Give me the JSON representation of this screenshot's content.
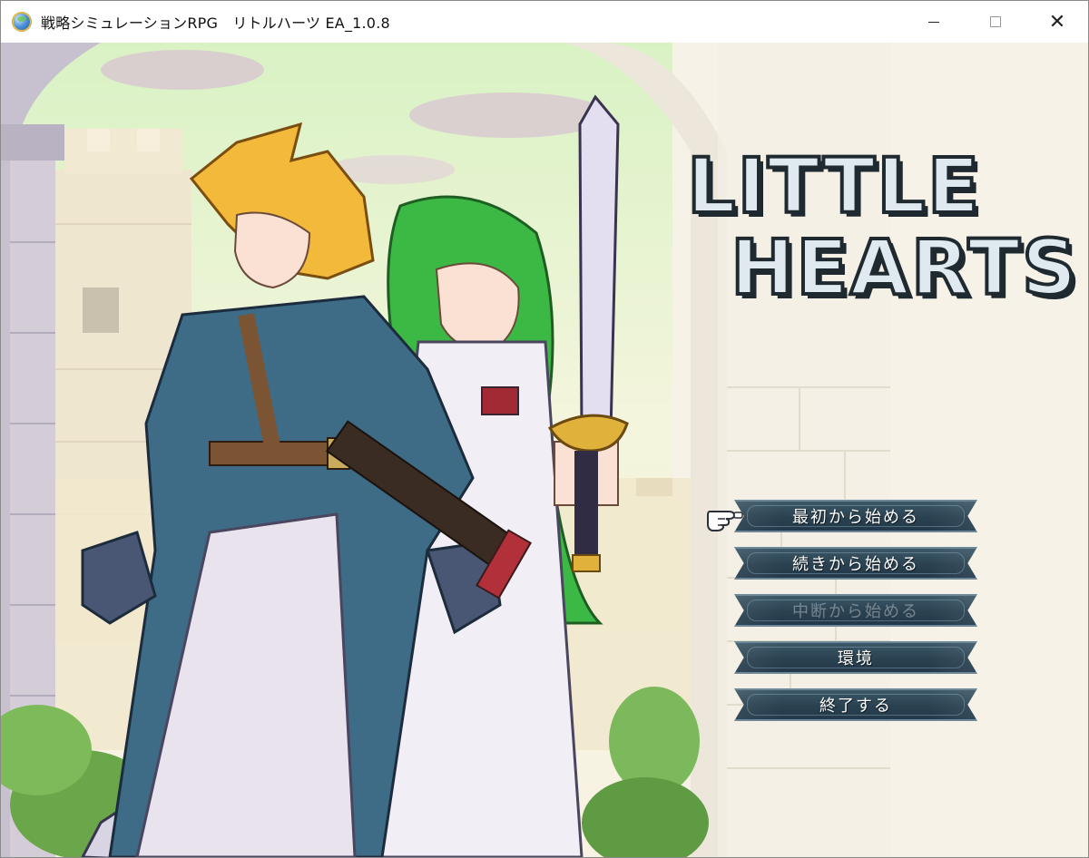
{
  "window": {
    "title": "戦略シミュレーションRPG　リトルハーツ EA_1.0.8",
    "controls": {
      "minimize": "minimize",
      "maximize": "maximize",
      "close": "✕"
    }
  },
  "logo": {
    "line1": "LITTLE",
    "line2": "HEARTS"
  },
  "menu": {
    "items": [
      {
        "label": "最初から始める",
        "state": "selected"
      },
      {
        "label": "続きから始める",
        "state": "enabled"
      },
      {
        "label": "中断から始める",
        "state": "disabled"
      },
      {
        "label": "環境",
        "state": "enabled"
      },
      {
        "label": "終了する",
        "state": "enabled"
      }
    ]
  },
  "icons": {
    "app": "globe-icon",
    "cursor": "pointing-hand-icon"
  },
  "colors": {
    "menu_bg": "#2a4150",
    "menu_border": "#6f8897",
    "logo_fill": "#dfe9ef",
    "logo_outline": "#1f2a30"
  }
}
